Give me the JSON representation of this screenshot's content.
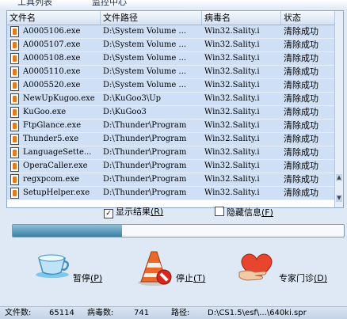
{
  "tabs": [
    {
      "label": "工具列表"
    },
    {
      "label": "监控中心"
    }
  ],
  "table": {
    "columns": [
      "文件名",
      "文件路径",
      "病毒名",
      "状态"
    ],
    "rows": [
      {
        "file": "A0005106.exe",
        "path": "D:\\System Volume ...",
        "virus": "Win32.Sality.i",
        "status": "清除成功"
      },
      {
        "file": "A0005107.exe",
        "path": "D:\\System Volume ...",
        "virus": "Win32.Sality.i",
        "status": "清除成功"
      },
      {
        "file": "A0005108.exe",
        "path": "D:\\System Volume ...",
        "virus": "Win32.Sality.i",
        "status": "清除成功"
      },
      {
        "file": "A0005110.exe",
        "path": "D:\\System Volume ...",
        "virus": "Win32.Sality.i",
        "status": "清除成功"
      },
      {
        "file": "A0005520.exe",
        "path": "D:\\System Volume ...",
        "virus": "Win32.Sality.i",
        "status": "清除成功"
      },
      {
        "file": "NewUpKugoo.exe",
        "path": "D:\\KuGoo3\\Up",
        "virus": "Win32.Sality.i",
        "status": "清除成功"
      },
      {
        "file": "KuGoo.exe",
        "path": "D:\\KuGoo3",
        "virus": "Win32.Sality.i",
        "status": "清除成功"
      },
      {
        "file": "FtpGlance.exe",
        "path": "D:\\Thunder\\Program",
        "virus": "Win32.Sality.i",
        "status": "清除成功"
      },
      {
        "file": "Thunder5.exe",
        "path": "D:\\Thunder\\Program",
        "virus": "Win32.Sality.i",
        "status": "清除成功"
      },
      {
        "file": "LanguageSette...",
        "path": "D:\\Thunder\\Program",
        "virus": "Win32.Sality.i",
        "status": "清除成功"
      },
      {
        "file": "OperaCaller.exe",
        "path": "D:\\Thunder\\Program",
        "virus": "Win32.Sality.i",
        "status": "清除成功"
      },
      {
        "file": "regxpcom.exe",
        "path": "D:\\Thunder\\Program",
        "virus": "Win32.Sality.i",
        "status": "清除成功"
      },
      {
        "file": "SetupHelper.exe",
        "path": "D:\\Thunder\\Program",
        "virus": "Win32.Sality.i",
        "status": "清除成功"
      }
    ]
  },
  "options": {
    "show_results": {
      "label": "显示结果",
      "hotkey": "(R)",
      "checked": true
    },
    "hide_info": {
      "label": "隐藏信息",
      "hotkey": "(F)",
      "checked": false
    }
  },
  "progress": {
    "fraction": 0.33
  },
  "buttons": {
    "pause": {
      "label": "暂停",
      "hotkey": "(P)",
      "icon": "coffee-cup-icon"
    },
    "stop": {
      "label": "停止",
      "hotkey": "(T)",
      "icon": "traffic-cone-stop-icon"
    },
    "expert": {
      "label": "专家门诊",
      "hotkey": "(D)",
      "icon": "heart-hand-icon"
    }
  },
  "status_bar": {
    "files_label": "文件数:",
    "files_value": "65114",
    "virus_label": "病毒数:",
    "virus_value": "741",
    "path_label": "路径:",
    "path_value": "D:\\CS1.5\\esf\\...\\640ki.spr"
  },
  "colors": {
    "row_selected": "#cfe0f6",
    "progress_fill": "#3a7fa3",
    "accent": "#1f5aa8"
  }
}
